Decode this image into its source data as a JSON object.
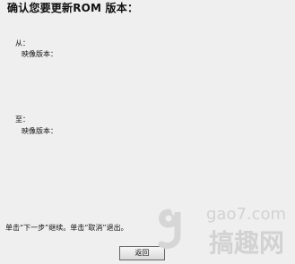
{
  "title": "确认您要更新ROM 版本：",
  "from": {
    "label": "从：",
    "image_version_label": "映像版本："
  },
  "to": {
    "label": "至：",
    "image_version_label": "映像版本："
  },
  "instruction": "单击“下一步”继续。单击“取消”退出。",
  "buttons": {
    "back": "返回"
  },
  "watermark": {
    "site": "gao7.com",
    "brand": "搞趣网"
  }
}
